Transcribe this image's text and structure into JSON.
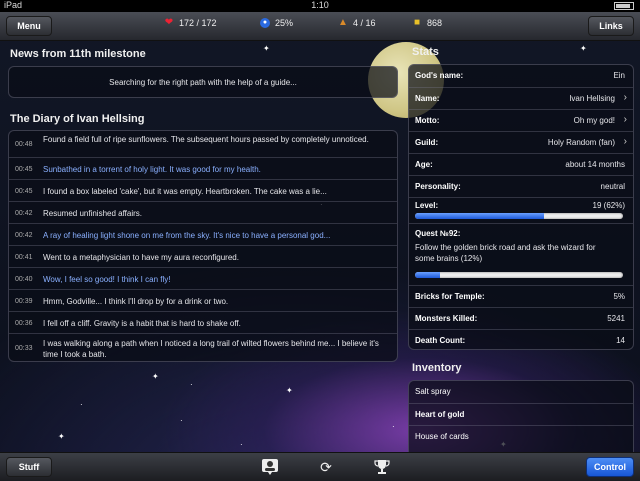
{
  "status_bar": {
    "carrier": "iPad",
    "time": "1:10"
  },
  "topbar": {
    "menu_label": "Menu",
    "health": "172 / 172",
    "gold_pct": "25%",
    "inventory_count": "4 / 16",
    "gold": "868",
    "links_label": "Links"
  },
  "news": {
    "title": "News from 11th milestone",
    "text": "Searching for the right path with the help of a guide..."
  },
  "diary": {
    "title": "The Diary of Ivan Hellsing",
    "entries": [
      {
        "time": "00:48",
        "text": "Found a field full of ripe sunflowers. The subsequent hours passed by completely unnoticed."
      },
      {
        "time": "00:45",
        "text": "Sunbathed in a torrent of holy light. It was good for my health."
      },
      {
        "time": "00:45",
        "text": "I found a box labeled 'cake', but it was empty. Heartbroken. The cake was a lie..."
      },
      {
        "time": "00:42",
        "text": "Resumed unfinished affairs."
      },
      {
        "time": "00:42",
        "text": "A ray of healing light shone on me from the sky. It's nice to have a personal god..."
      },
      {
        "time": "00:41",
        "text": "Went to a metaphysician to have my aura reconfigured."
      },
      {
        "time": "00:40",
        "text": "Wow, I feel so good! I think I can fly!"
      },
      {
        "time": "00:39",
        "text": "Hmm, Godville... I think I'll drop by for a drink or two."
      },
      {
        "time": "00:36",
        "text": "I fell off a cliff. Gravity is a habit that is hard to shake off."
      },
      {
        "time": "00:33",
        "text": "I was walking along a path when I noticed a long trail of wilted flowers behind me... I believe it's time I took a bath."
      }
    ]
  },
  "stats": {
    "title": "Stats",
    "gods_name_label": "God's name:",
    "gods_name": "Ein",
    "name_label": "Name:",
    "name": "Ivan Hellsing",
    "motto_label": "Motto:",
    "motto": "Oh my god!",
    "guild_label": "Guild:",
    "guild": "Holy Random (fan)",
    "age_label": "Age:",
    "age": "about 14 months",
    "personality_label": "Personality:",
    "personality": "neutral",
    "level_label": "Level:",
    "level": "19 (62%)",
    "level_progress": 0.62,
    "quest_label": "Quest №92:",
    "quest_text": "Follow the golden brick road and ask the wizard for some brains (12%)",
    "quest_progress": 0.12,
    "bricks_label": "Bricks for Temple:",
    "bricks": "5%",
    "monsters_label": "Monsters Killed:",
    "monsters": "5241",
    "deaths_label": "Death Count:",
    "deaths": "14"
  },
  "inventory": {
    "title": "Inventory",
    "items": [
      {
        "name": "Salt spray",
        "bold": false
      },
      {
        "name": "Heart of gold",
        "bold": true
      },
      {
        "name": "House of cards",
        "bold": false
      }
    ]
  },
  "bottombar": {
    "stuff_label": "Stuff",
    "control_label": "Control"
  },
  "colors": {
    "accent_blue": "#1f63e0",
    "diary_highlight": "#8ab0ff"
  }
}
